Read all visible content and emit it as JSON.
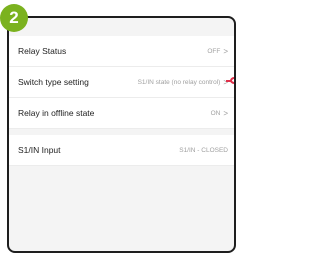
{
  "step_badge": "2",
  "settings": [
    {
      "label": "Relay Status",
      "value": "OFF",
      "chevron": ">"
    },
    {
      "label": "Switch type setting",
      "value": "S1/IN state (no relay control)",
      "chevron": ">"
    },
    {
      "label": "Relay in offline state",
      "value": "ON",
      "chevron": ">"
    }
  ],
  "input": {
    "label": "S1/IN Input",
    "value": "S1/IN - CLOSED"
  },
  "accent_colors": {
    "badge": "#7bb21f",
    "pointer": "#e0304a"
  }
}
